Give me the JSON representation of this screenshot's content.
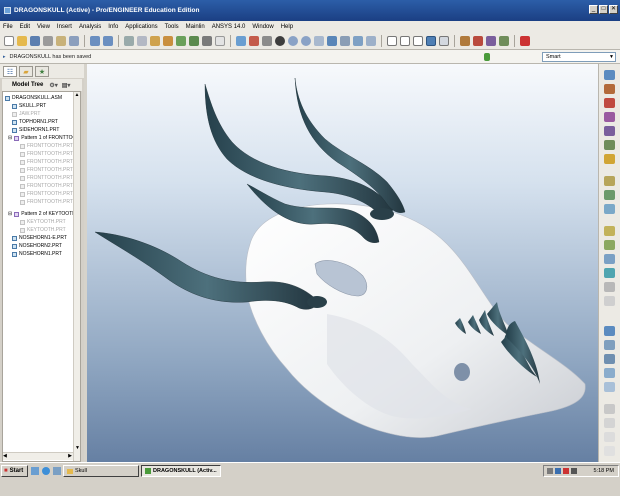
{
  "window": {
    "title": "DRAGONSKULL (Active) - Pro/ENGINEER Education Edition",
    "icon": "proe-app-icon",
    "buttons": [
      "_",
      "□",
      "✕"
    ]
  },
  "menu": [
    "File",
    "Edit",
    "View",
    "Insert",
    "Analysis",
    "Info",
    "Applications",
    "Tools",
    "Mainlin",
    "ANSYS 14.0",
    "Window",
    "Help"
  ],
  "toolbar": {
    "colors": [
      "#4f7fb4",
      "#d9a43a",
      "#8aa2c6",
      "#6b8e5a",
      "#c45b4b",
      "#8b8b8b",
      "#4f7fb4",
      "#a3a3a3",
      "#c9932f",
      "#5a86b8"
    ]
  },
  "message": {
    "text": "DRAGONSKULL has been saved",
    "selection_filter": "Smart"
  },
  "navigator": {
    "tabs": [
      "model-tree-tab",
      "folder-browser-tab",
      "favorites-tab"
    ],
    "header": "Model Tree",
    "tree": [
      {
        "label": "DRAGONSKULL.ASM",
        "dim": false
      },
      {
        "label": "SKULL.PRT",
        "dim": false
      },
      {
        "label": "JAW.PRT",
        "dim": true
      },
      {
        "label": "TOPHORN1.PRT",
        "dim": false
      },
      {
        "label": "SIDEHORN1.PRT",
        "dim": false
      },
      {
        "label": "Pattern 1 of FRONTTOO",
        "dim": false
      },
      {
        "label": "FRONTTOOTH.PRT",
        "dim": true
      },
      {
        "label": "FRONTTOOTH.PRT",
        "dim": true
      },
      {
        "label": "FRONTTOOTH.PRT",
        "dim": true
      },
      {
        "label": "FRONTTOOTH.PRT",
        "dim": true
      },
      {
        "label": "FRONTTOOTH.PRT",
        "dim": true
      },
      {
        "label": "FRONTTOOTH.PRT",
        "dim": true
      },
      {
        "label": "FRONTTOOTH.PRT",
        "dim": true
      },
      {
        "label": "FRONTTOOTH.PRT",
        "dim": true
      },
      {
        "label": "Pattern 2 of KEYTOOTH",
        "dim": false
      },
      {
        "label": "KEYTOOTH.PRT",
        "dim": true
      },
      {
        "label": "KEYTOOTH.PRT",
        "dim": true
      },
      {
        "label": "NOSEHORN1-E.PRT",
        "dim": false
      },
      {
        "label": "NOSEHORN2.PRT",
        "dim": false
      },
      {
        "label": "NOSEHORN1.PRT",
        "dim": false
      }
    ]
  },
  "colors": {
    "skull": "#f2f2f2",
    "horn": "#2f4a56",
    "horn_highlight": "#5d7f8c",
    "title_bar": "#1f4a96"
  },
  "taskbar": {
    "start": "Start",
    "tasks": [
      "Skull",
      "DRAGONSKULL (Activ..."
    ],
    "clock": "5:18 PM"
  }
}
